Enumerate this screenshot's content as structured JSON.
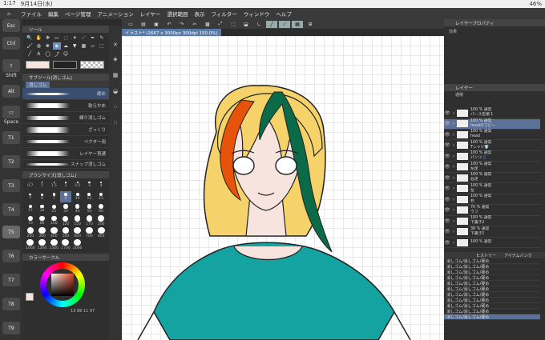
{
  "status_bar": {
    "time": "1:17",
    "date": "9月14日(水)",
    "battery": "46%"
  },
  "menu": [
    "ファイル",
    "編集",
    "ページ管理",
    "アニメーション",
    "レイヤー",
    "選択範囲",
    "表示",
    "フィルター",
    "ウィンドウ",
    "ヘルプ"
  ],
  "left_keys": [
    {
      "label": "Esc"
    },
    {
      "label": "Ctrl"
    },
    {
      "label": "⇧",
      "sub": "Shift"
    },
    {
      "label": "Alt"
    },
    {
      "label": "▭",
      "sub": "Space"
    },
    {
      "label": "",
      "sub": "T1"
    },
    {
      "label": "",
      "sub": "T2"
    },
    {
      "label": "",
      "sub": "T3"
    },
    {
      "label": "",
      "sub": "T4"
    },
    {
      "label": "",
      "sub": "T5"
    },
    {
      "label": "",
      "sub": "T6"
    },
    {
      "label": "",
      "sub": "T7"
    },
    {
      "label": "",
      "sub": "T8"
    },
    {
      "label": "",
      "sub": "T9"
    }
  ],
  "tool_panel": {
    "title": "ツール",
    "sub_tool_title": "サブツール[消しゴム]",
    "sub_tool_tab": "消しゴム",
    "brushes": [
      "硬め",
      "軟らかめ",
      "練り消しゴム",
      "ざっくり",
      "ベクター用",
      "レイヤー貫通",
      "スナップ消しゴム"
    ],
    "brush_size_title": "ブラシサイズ[消しゴム]",
    "brush_sizes": [
      "0.7",
      "1",
      "1.5",
      "2",
      "2.5",
      "3",
      "4",
      "5",
      "6",
      "7",
      "8",
      "10",
      "12",
      "15",
      "17",
      "20",
      "25",
      "30",
      "40",
      "50",
      "60",
      "70",
      "80",
      "100",
      "120",
      "150",
      "170",
      "200",
      "250",
      "300",
      "400",
      "500",
      "600",
      "700",
      "800",
      "1000",
      "1200",
      "1500",
      "1700",
      "2000"
    ],
    "color_circle_title": "カラーサークル",
    "color_readout": "13 88 11 97"
  },
  "canvas_tab": "イラスト* (2667 x 3000px 300dpi 150.0%)",
  "right_panel": {
    "layer_property_title": "レイヤープロパティ",
    "effect_label": "効果",
    "layer_title": "レイヤー",
    "blend_mode": "通常",
    "layers": [
      {
        "pct": "100 % 通常",
        "name": "パース定規 1"
      },
      {
        "pct": "100 % 通常",
        "name": "headのコピー"
      },
      {
        "pct": "100 % 通常",
        "name": "head"
      },
      {
        "pct": "100 % 通常",
        "name": "Tシャツ👕"
      },
      {
        "pct": "100 % 通常",
        "name": "パンツ👖"
      },
      {
        "pct": "100 % 通常",
        "name": "左足"
      },
      {
        "pct": "100 % 通常",
        "name": "右足"
      },
      {
        "pct": "100 % 通常",
        "name": "左"
      },
      {
        "pct": "100 % 通常",
        "name": "右"
      },
      {
        "pct": "70 % 通常",
        "name": "ラフ"
      },
      {
        "pct": "100 % 通常",
        "name": "下書き2"
      },
      {
        "pct": "38 % 通常",
        "name": "下書き1"
      },
      {
        "pct": "100 % 通常",
        "name": ""
      }
    ],
    "history_tabs": [
      "ヒストリー",
      "アイテムバンク"
    ],
    "history": [
      "消しゴム/消しゴム/硬め",
      "消しゴム/消しゴム/硬め",
      "消しゴム/消しゴム/硬め",
      "消しゴム/消しゴム/硬め",
      "消しゴム/消しゴム/硬め",
      "消しゴム/消しゴム/硬め",
      "消しゴム/消しゴム/硬め",
      "消しゴム/消しゴム/硬め",
      "消しゴム/消しゴム/硬め",
      "消しゴム/消しゴム/硬め",
      "消しゴム/消しゴム/硬め"
    ]
  },
  "colors": {
    "hair": "#f5d36a",
    "orange": "#e8530c",
    "green": "#0b6b48",
    "shirt": "#14a3a0",
    "skin": "#f8e4df",
    "accent": "#5c7198"
  }
}
